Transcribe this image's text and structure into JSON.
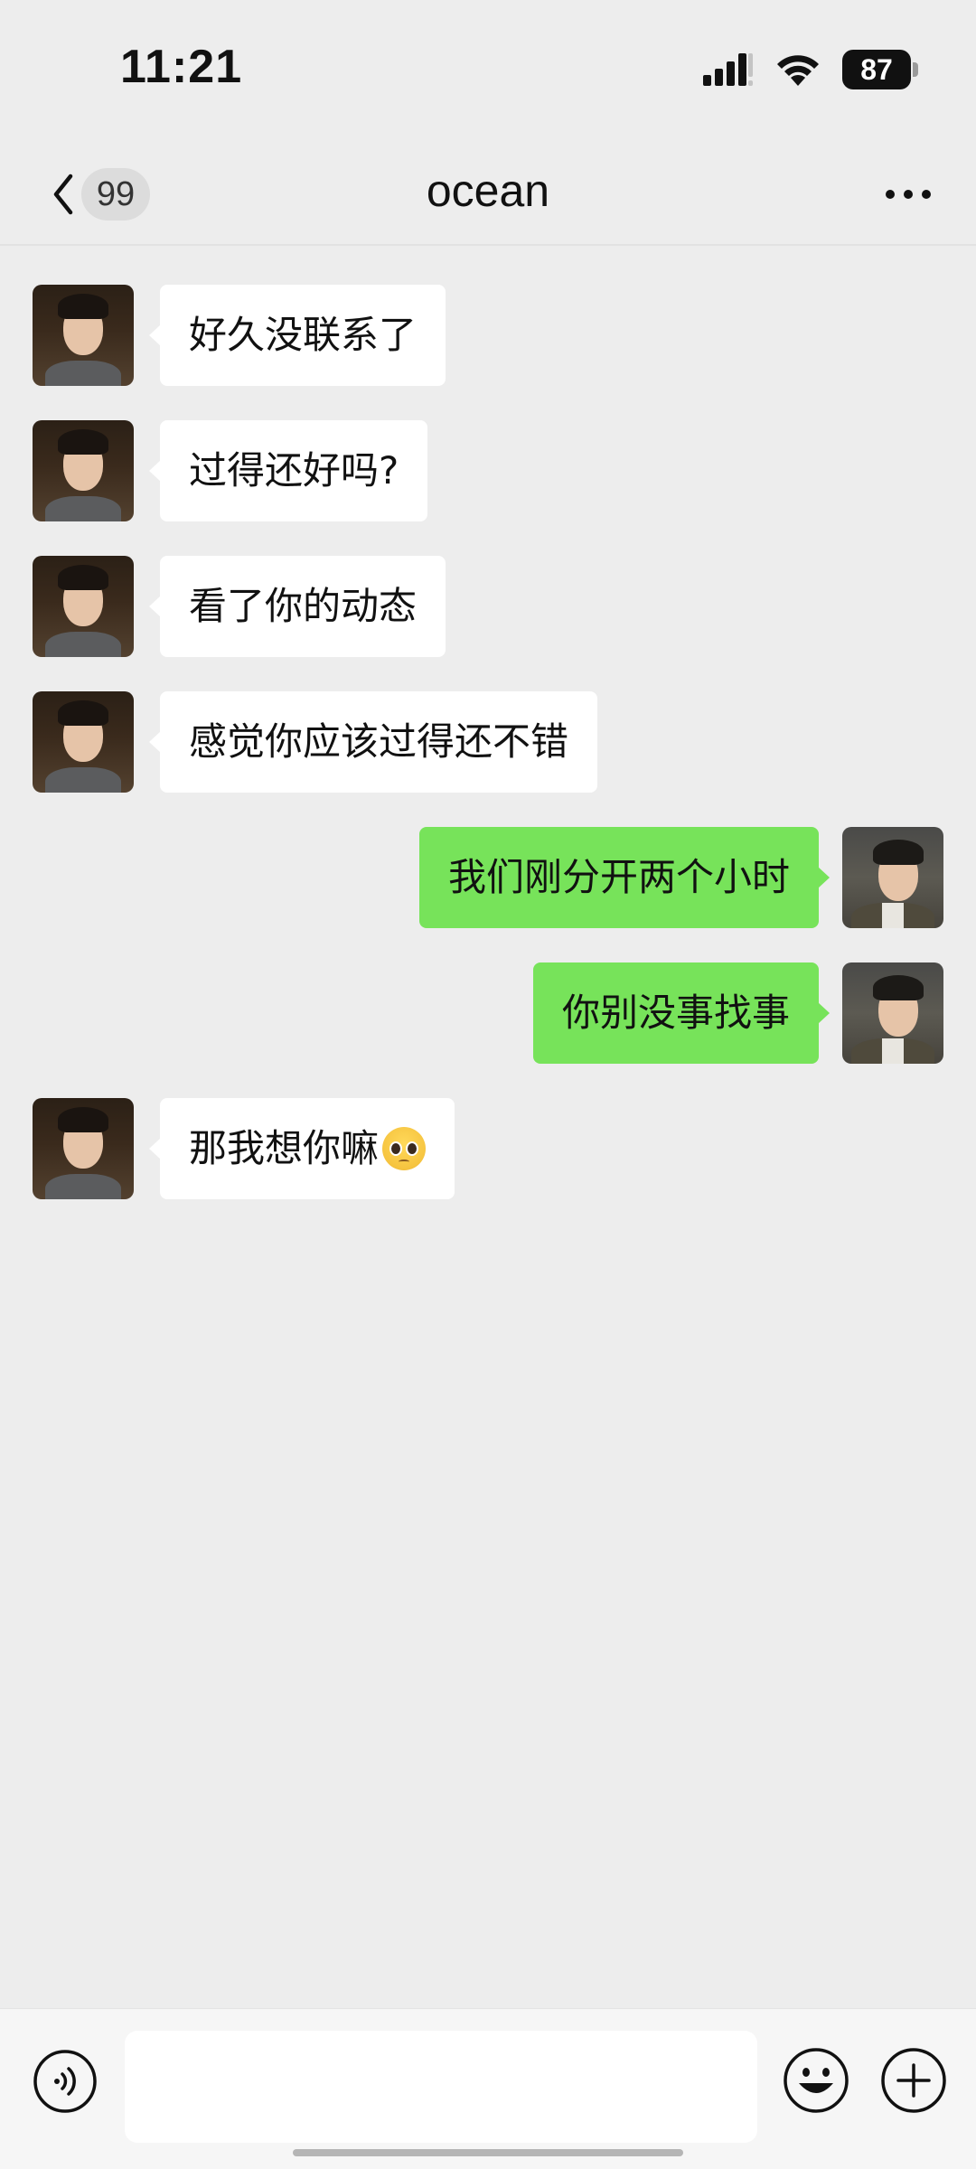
{
  "status_bar": {
    "time": "11:21",
    "battery_level": "87"
  },
  "nav": {
    "title": "ocean",
    "unread_count": "99"
  },
  "messages": [
    {
      "sender": "other",
      "text": "好久没联系了"
    },
    {
      "sender": "other",
      "text": "过得还好吗?"
    },
    {
      "sender": "other",
      "text": "看了你的动态"
    },
    {
      "sender": "other",
      "text": "感觉你应该过得还不错"
    },
    {
      "sender": "self",
      "text": "我们刚分开两个小时"
    },
    {
      "sender": "self",
      "text": "你别没事找事"
    },
    {
      "sender": "other",
      "text": "那我想你嘛",
      "emoji": "pleading-face-icon"
    }
  ],
  "input_bar": {
    "value": "",
    "icons": [
      "voice-icon",
      "emoji-icon",
      "plus-icon"
    ]
  },
  "colors": {
    "background": "#ededed",
    "self_bubble": "#77e35a",
    "other_bubble": "#ffffff"
  }
}
